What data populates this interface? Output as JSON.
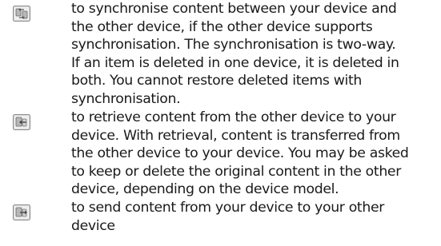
{
  "entries": [
    {
      "icon": "synchronise-icon",
      "text": "to synchronise content between your device and\nthe other device, if the other device supports\nsynchronisation. The synchronisation is two-way.\nIf an item is deleted in one device, it is deleted in\nboth. You cannot restore deleted items with\nsynchronisation."
    },
    {
      "icon": "retrieve-icon",
      "text": "to retrieve content from the other device to your\ndevice. With retrieval, content is transferred from\nthe other device to your device. You may be asked\nto keep or delete the original content in the other\ndevice, depending on the device model."
    },
    {
      "icon": "send-icon",
      "text": "to send content from your device to your other\ndevice"
    }
  ]
}
